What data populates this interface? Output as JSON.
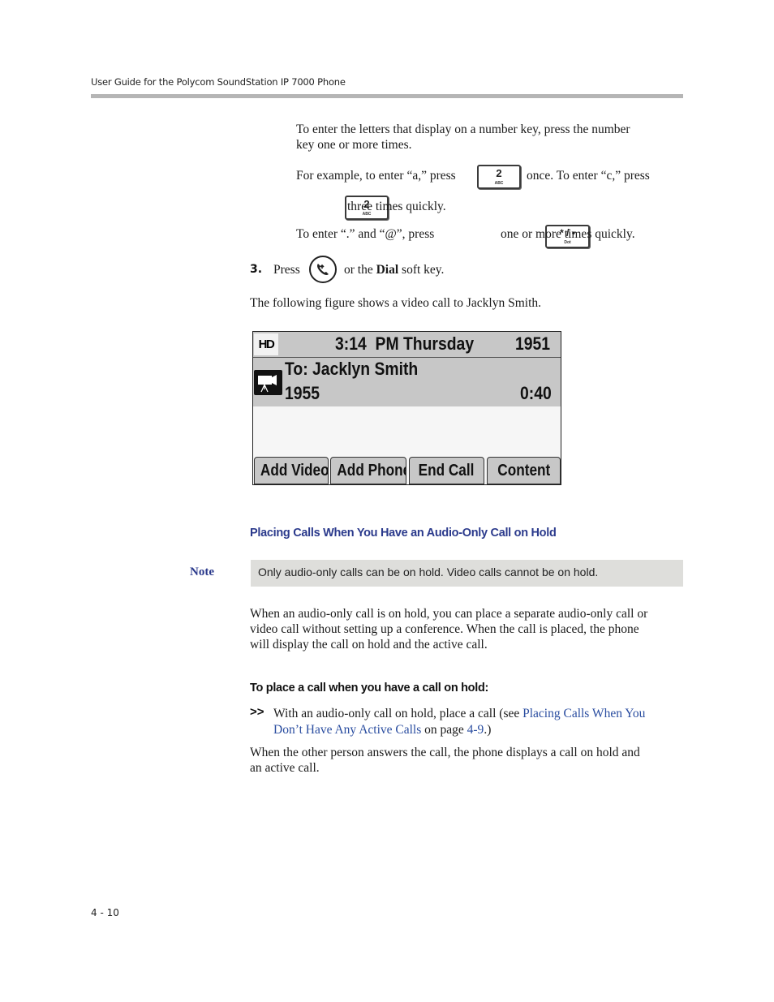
{
  "header": {
    "running_title": "User Guide for the Polycom SoundStation IP 7000 Phone"
  },
  "instructions": {
    "letters_line1": "To enter the letters that display on a number key, press the number",
    "letters_line2": "key one or more times.",
    "example_prefix": "For example, to enter “a,” press",
    "example_middle": "once. To enter “c,” press",
    "example_suffix": "three times quickly.",
    "symbols_prefix": "To enter “.” and “@”, press",
    "symbols_suffix": "one or more times quickly.",
    "key_2": {
      "number": "2",
      "letters": "ABC"
    },
    "key_star": {
      "number": "* / •",
      "letters": "Dot"
    }
  },
  "step3": {
    "number": "3.",
    "prefix": "Press",
    "icon": "send-call-icon",
    "suffix_pre": "or the",
    "bold_word": "Dial",
    "suffix_post": "soft key."
  },
  "figure_intro": "The following figure shows a video call to Jacklyn Smith.",
  "phone_screen": {
    "hd_badge": "HD",
    "time": "3:14",
    "period_day": "PM Thursday",
    "line_number": "1951",
    "call_icon": "video-camera-icon",
    "call_to": "To: Jacklyn Smith",
    "call_number": "1955",
    "call_duration": "0:40",
    "softkeys": [
      "Add Video",
      "Add Phone",
      "End Call",
      "Content"
    ]
  },
  "section": {
    "title": "Placing Calls When You Have an Audio-Only Call on Hold",
    "note_label": "Note",
    "note_text": "Only audio-only calls can be on hold. Video calls cannot be on hold.",
    "para_line1": "When an audio-only call is on hold, you can place a separate audio-only call or",
    "para_line2": "video call without setting up a conference. When the call is placed, the phone",
    "para_line3": "will display the call on hold and the active call.",
    "procedure_title": "To place a call when you have a call on hold:",
    "bullet_marker": ">>",
    "bullet_line1_text": "With an audio-only call on hold, place a call (see",
    "bullet_link1": "Placing Calls When You",
    "bullet_link2": "Don’t Have Any Active Calls",
    "bullet_line2_text": "on page",
    "bullet_page_link": "4-9",
    "bullet_line2_end": ".)",
    "result_line1": "When the other person answers the call, the phone displays a call on hold and",
    "result_line2": "an active call."
  },
  "footer": {
    "page_number": "4 - 10"
  }
}
